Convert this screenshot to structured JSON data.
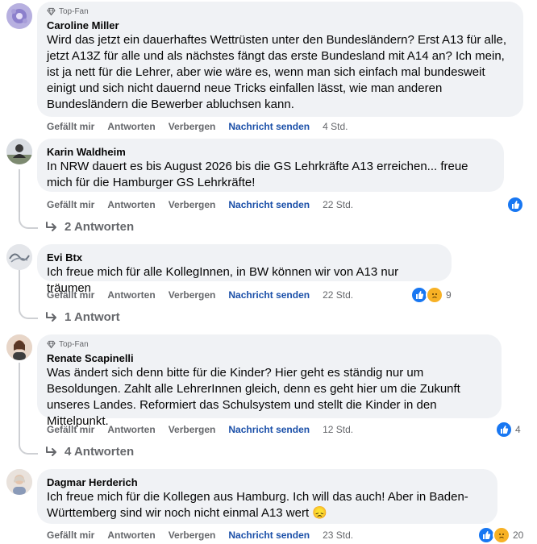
{
  "labels": {
    "like": "Gefällt mir",
    "reply": "Antworten",
    "hide": "Verbergen",
    "message": "Nachricht senden",
    "top_fan": "Top-Fan"
  },
  "comments": [
    {
      "author": "Caroline Miller",
      "badge": "Top-Fan",
      "text": "Wird das jetzt ein dauerhaftes Wettrüsten unter den Bundesländern? Erst A13 für alle, jetzt A13Z für alle und als nächstes fängt das erste Bundesland mit A14 an? Ich mein, ist ja nett für die Lehrer, aber wie wäre es, wenn man sich einfach mal bundesweit einigt und sich nicht dauernd neue Tricks einfallen lässt, wie man anderen Bundesländern die Bewerber abluchsen kann.",
      "time": "4 Std.",
      "avatar_color": "#9a8fd0"
    },
    {
      "author": "Karin Waldheim",
      "text": "In NRW dauert es bis August 2026 bis die GS Lehrkräfte A13 erreichen... freue mich für die Hamburger GS Lehrkräfte!",
      "time": "22 Std.",
      "replies_label": "2 Antworten",
      "avatar_color": "#6b7a64"
    },
    {
      "author": "Evi Btx",
      "text": "Ich freue mich für alle KollegInnen, in BW können wir von A13 nur träumen",
      "time": "22 Std.",
      "reaction_count": "9",
      "replies_label": "1 Antwort",
      "avatar_color": "#b8bcc4"
    },
    {
      "author": "Renate Scapinelli",
      "badge": "Top-Fan",
      "text": "Was ändert sich denn bitte für die Kinder? Hier geht es ständig nur um Besoldungen. Zahlt alle LehrerInnen gleich, denn es geht hier um die Zukunft unseres Landes. Reformiert das Schulsystem und stellt die Kinder in den Mittelpunkt.",
      "time": "12 Std.",
      "reaction_count": "4",
      "replies_label": "4 Antworten",
      "avatar_color": "#c9a48c"
    },
    {
      "author": "Dagmar Herderich",
      "text": "Ich freue mich für die Kollegen aus Hamburg. Ich will das auch! Aber in Baden-Württemberg sind wir noch nicht einmal A13 wert",
      "emoji": "😞",
      "time": "23 Std.",
      "reaction_count": "20",
      "avatar_color": "#d8c4b4"
    }
  ]
}
